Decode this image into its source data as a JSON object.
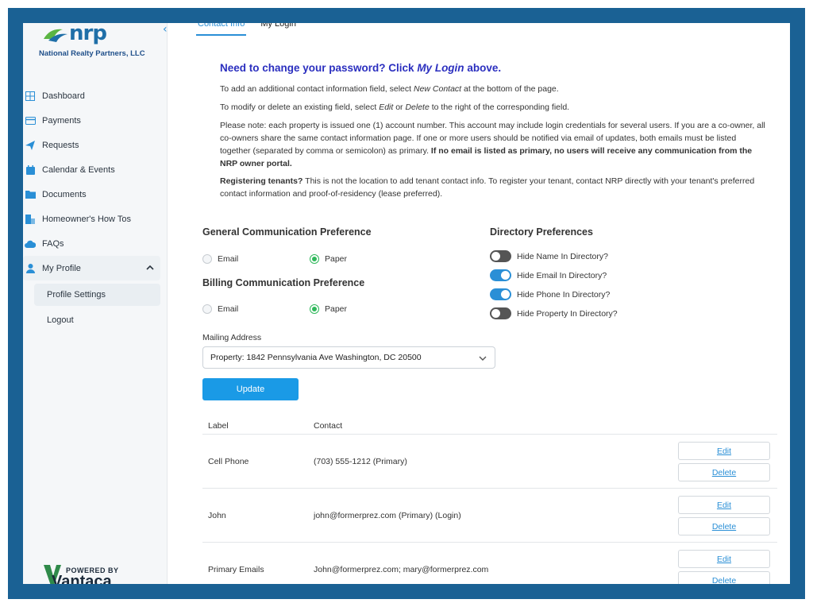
{
  "brand": {
    "logo_text": "nrp",
    "company": "National Realty Partners, LLC",
    "accent": "#2a8fd6",
    "frame_color": "#1a6194"
  },
  "sidebar": {
    "items": [
      {
        "label": "Dashboard",
        "icon": "dashboard-icon"
      },
      {
        "label": "Payments",
        "icon": "payments-icon"
      },
      {
        "label": "Requests",
        "icon": "send-icon"
      },
      {
        "label": "Calendar & Events",
        "icon": "calendar-icon"
      },
      {
        "label": "Documents",
        "icon": "folder-icon"
      },
      {
        "label": "Homeowner's How Tos",
        "icon": "book-icon"
      },
      {
        "label": "FAQs",
        "icon": "cloud-icon"
      },
      {
        "label": "My Profile",
        "icon": "user-icon"
      }
    ],
    "sub_items": [
      {
        "label": "Profile Settings"
      },
      {
        "label": "Logout"
      }
    ],
    "powered_by": "POWERED BY",
    "powered_name": "Vantaca"
  },
  "tabs": [
    {
      "label": "Contact Info"
    },
    {
      "label": "My Login"
    }
  ],
  "notice": {
    "heading_prefix": "Need to change your password?  Click ",
    "heading_link": "My Login",
    "heading_suffix": " above.",
    "line1_a": "To add an additional contact information field, select ",
    "line1_em": "New Contact",
    "line1_b": " at the bottom of the page.",
    "line2_a": "To modify or delete an existing field, select ",
    "line2_em1": "Edit",
    "line2_mid": " or ",
    "line2_em2": "Delete",
    "line2_b": " to the right of the corresponding field.",
    "line3": "Please note: each property is issued one (1) account number. This account may include login credentials for several users. If you are a co-owner, all co-owners share the same contact information page. If one or more users should be notified via email of updates, both emails must be listed together (separated by comma or semicolon) as primary. ",
    "line3_bold": "If no email is listed as primary, no users will receive any communication from the NRP owner portal.",
    "line4_bold": "Registering tenants?",
    "line4": " This is not the location to add tenant contact info. To register your tenant, contact NRP directly with your tenant's preferred contact information and proof-of-residency (lease preferred)."
  },
  "general_comm": {
    "title": "General Communication Preference",
    "options": [
      {
        "label": "Email",
        "selected": false
      },
      {
        "label": "Paper",
        "selected": true
      }
    ]
  },
  "billing_comm": {
    "title": "Billing Communication Preference",
    "options": [
      {
        "label": "Email",
        "selected": false
      },
      {
        "label": "Paper",
        "selected": true
      }
    ]
  },
  "directory": {
    "title": "Directory Preferences",
    "toggles": [
      {
        "label": "Hide Name In Directory?",
        "on": false
      },
      {
        "label": "Hide Email In Directory?",
        "on": true
      },
      {
        "label": "Hide Phone In Directory?",
        "on": true
      },
      {
        "label": "Hide Property In Directory?",
        "on": false
      }
    ]
  },
  "mailing": {
    "label": "Mailing Address",
    "value": "Property: 1842 Pennsylvania Ave Washington, DC 20500"
  },
  "update_label": "Update",
  "contacts": {
    "headers": {
      "label": "Label",
      "contact": "Contact"
    },
    "rows": [
      {
        "label": "Cell Phone",
        "contact": "(703) 555-1212 (Primary)"
      },
      {
        "label": "John",
        "contact": "john@formerprez.com (Primary) (Login)"
      },
      {
        "label": "Primary Emails",
        "contact": "John@formerprez.com; mary@formerprez.com"
      }
    ],
    "edit_label": "Edit",
    "delete_label": "Delete"
  }
}
